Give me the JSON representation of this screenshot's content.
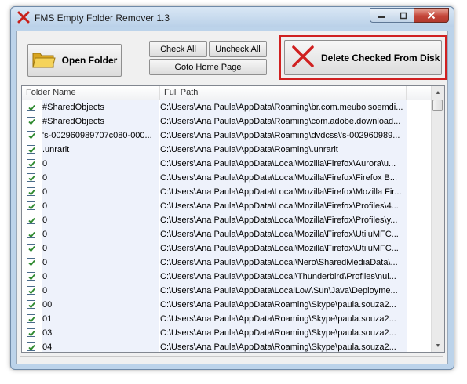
{
  "window": {
    "title": "FMS Empty Folder Remover 1.3"
  },
  "toolbar": {
    "open_folder": "Open Folder",
    "check_all": "Check All",
    "uncheck_all": "Uncheck All",
    "goto_home": "Goto Home Page",
    "delete_checked": "Delete Checked From Disk"
  },
  "list": {
    "columns": [
      "Folder Name",
      "Full Path"
    ],
    "rows": [
      {
        "checked": true,
        "name": "#SharedObjects",
        "path": "C:\\Users\\Ana Paula\\AppData\\Roaming\\br.com.meubolsoemdi..."
      },
      {
        "checked": true,
        "name": "#SharedObjects",
        "path": "C:\\Users\\Ana Paula\\AppData\\Roaming\\com.adobe.download..."
      },
      {
        "checked": true,
        "name": "'s-002960989707c080-000...",
        "path": "C:\\Users\\Ana Paula\\AppData\\Roaming\\dvdcss\\'s-002960989..."
      },
      {
        "checked": true,
        "name": ".unrarit",
        "path": "C:\\Users\\Ana Paula\\AppData\\Roaming\\.unrarit"
      },
      {
        "checked": true,
        "name": "0",
        "path": "C:\\Users\\Ana Paula\\AppData\\Local\\Mozilla\\Firefox\\Aurora\\u..."
      },
      {
        "checked": true,
        "name": "0",
        "path": "C:\\Users\\Ana Paula\\AppData\\Local\\Mozilla\\Firefox\\Firefox B..."
      },
      {
        "checked": true,
        "name": "0",
        "path": "C:\\Users\\Ana Paula\\AppData\\Local\\Mozilla\\Firefox\\Mozilla Fir..."
      },
      {
        "checked": true,
        "name": "0",
        "path": "C:\\Users\\Ana Paula\\AppData\\Local\\Mozilla\\Firefox\\Profiles\\4..."
      },
      {
        "checked": true,
        "name": "0",
        "path": "C:\\Users\\Ana Paula\\AppData\\Local\\Mozilla\\Firefox\\Profiles\\y..."
      },
      {
        "checked": true,
        "name": "0",
        "path": "C:\\Users\\Ana Paula\\AppData\\Local\\Mozilla\\Firefox\\UtiluMFC..."
      },
      {
        "checked": true,
        "name": "0",
        "path": "C:\\Users\\Ana Paula\\AppData\\Local\\Mozilla\\Firefox\\UtiluMFC..."
      },
      {
        "checked": true,
        "name": "0",
        "path": "C:\\Users\\Ana Paula\\AppData\\Local\\Nero\\SharedMediaData\\..."
      },
      {
        "checked": true,
        "name": "0",
        "path": "C:\\Users\\Ana Paula\\AppData\\Local\\Thunderbird\\Profiles\\nui..."
      },
      {
        "checked": true,
        "name": "0",
        "path": "C:\\Users\\Ana Paula\\AppData\\LocalLow\\Sun\\Java\\Deployme..."
      },
      {
        "checked": true,
        "name": "00",
        "path": "C:\\Users\\Ana Paula\\AppData\\Roaming\\Skype\\paula.souza2..."
      },
      {
        "checked": true,
        "name": "01",
        "path": "C:\\Users\\Ana Paula\\AppData\\Roaming\\Skype\\paula.souza2..."
      },
      {
        "checked": true,
        "name": "03",
        "path": "C:\\Users\\Ana Paula\\AppData\\Roaming\\Skype\\paula.souza2..."
      },
      {
        "checked": true,
        "name": "04",
        "path": "C:\\Users\\Ana Paula\\AppData\\Roaming\\Skype\\paula.souza2..."
      }
    ]
  },
  "icons": {
    "app": "red-x-icon",
    "open_folder": "folder-icon",
    "delete": "red-x-icon",
    "checkbox": "checkmark-icon"
  },
  "colors": {
    "accent_red": "#d02020",
    "checkmark_green": "#2f8a2f",
    "row_highlight": "#eef2fb"
  }
}
